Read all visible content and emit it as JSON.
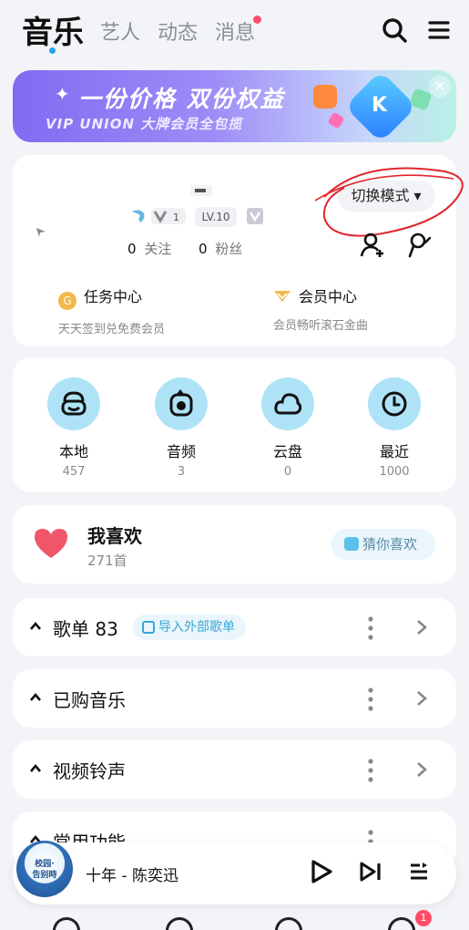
{
  "top_tabs": {
    "music": "音乐",
    "artist": "艺人",
    "dynamic": "动态",
    "messages": "消息"
  },
  "banner": {
    "headline": "一份价格 双份权益",
    "subline": "VIP UNION 大牌会员全包揽",
    "badge_letter": "K"
  },
  "profile": {
    "switch_mode": "切换模式 ▾",
    "level": "LV.10",
    "follow_count": "0",
    "follow_label": "关注",
    "fans_count": "0",
    "fans_label": "粉丝",
    "task_center": {
      "title": "任务中心",
      "sub": "天天签到兑免费会员",
      "coin": "G"
    },
    "vip_center": {
      "title": "会员中心",
      "sub": "会员畅听滚石金曲"
    }
  },
  "grid": [
    {
      "label": "本地",
      "count": "457"
    },
    {
      "label": "音频",
      "count": "3"
    },
    {
      "label": "云盘",
      "count": "0"
    },
    {
      "label": "最近",
      "count": "1000"
    }
  ],
  "favorites": {
    "title": "我喜欢",
    "count": "271首",
    "guess": "猜你喜欢"
  },
  "rows": {
    "playlists": {
      "title": "歌单 83",
      "import": "导入外部歌单"
    },
    "purchased": {
      "title": "已购音乐"
    },
    "ringtone": {
      "title": "视频铃声"
    },
    "common": {
      "title": "常用功能"
    }
  },
  "player": {
    "song": "十年  -  陈奕迅",
    "cover_text_1": "校园·",
    "cover_text_2": "告别時"
  },
  "bottom_nav": {
    "badge": "1"
  },
  "colors": {
    "accent": "#22a6e6",
    "icon_bg": "#aee3f7",
    "heart": "#f0566a",
    "scribble": "#e0262b"
  }
}
